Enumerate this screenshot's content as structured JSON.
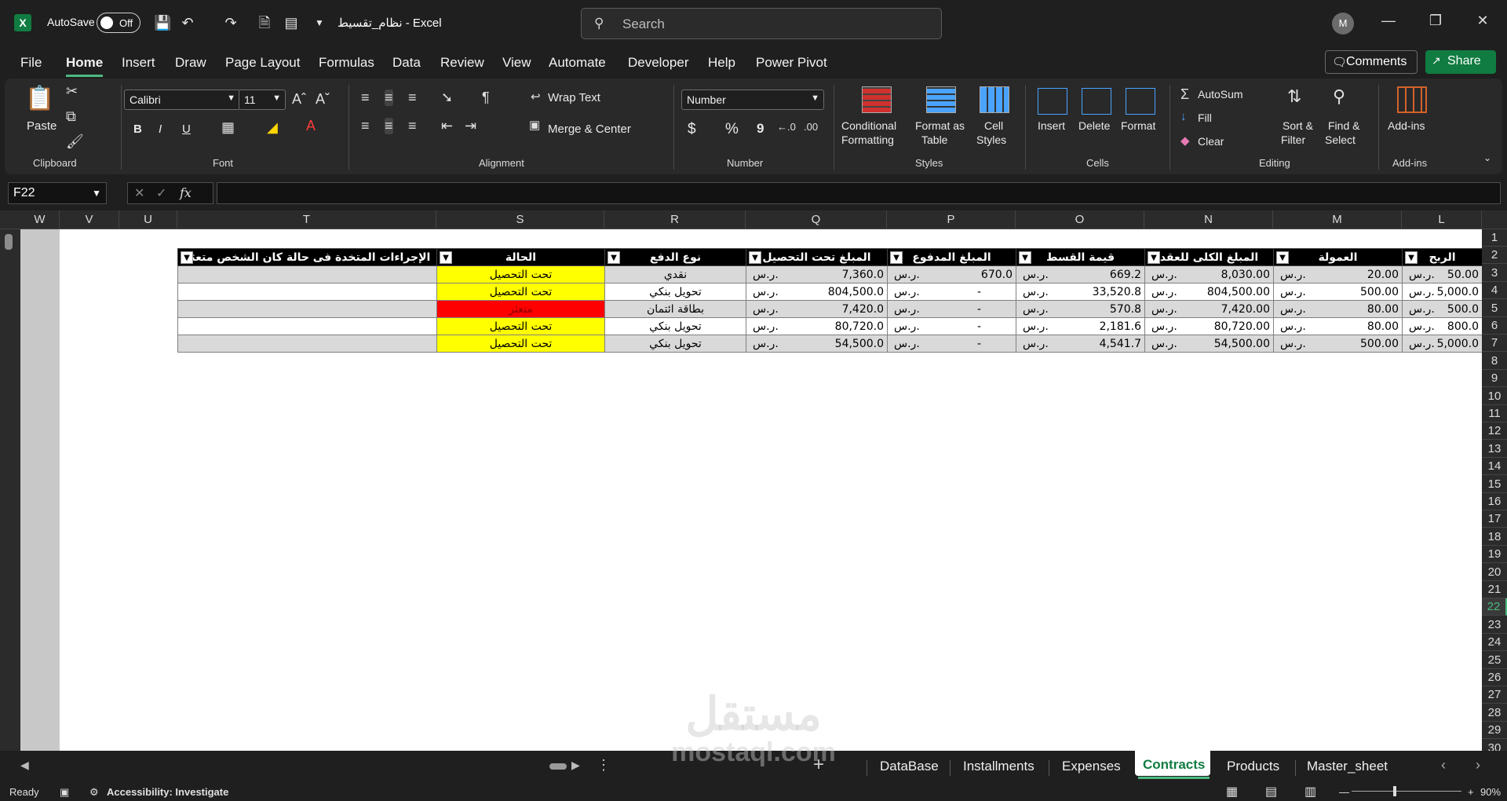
{
  "titlebar": {
    "autosave_label": "AutoSave",
    "autosave_state": "Off",
    "document_title": "نظام_تقسيط  -  Excel",
    "search_placeholder": "Search",
    "avatar_initial": "M"
  },
  "menu": {
    "tabs": [
      "File",
      "Home",
      "Insert",
      "Draw",
      "Page Layout",
      "Formulas",
      "Data",
      "Review",
      "View",
      "Automate",
      "Developer",
      "Help",
      "Power Pivot"
    ],
    "active_tab": "Home",
    "comments_label": "Comments",
    "share_label": "Share"
  },
  "ribbon": {
    "clipboard": {
      "paste": "Paste",
      "label": "Clipboard"
    },
    "font": {
      "family": "Calibri",
      "size": "11",
      "label": "Font",
      "bold": "B",
      "italic": "I",
      "underline": "U"
    },
    "alignment": {
      "wrap_text": "Wrap Text",
      "merge_center": "Merge & Center",
      "label": "Alignment"
    },
    "number": {
      "format": "Number",
      "label": "Number",
      "currency": "$",
      "percent": "%",
      "comma": "9"
    },
    "styles": {
      "conditional": "Conditional",
      "conditional2": "Formatting",
      "format_as": "Format as",
      "format_as2": "Table",
      "cell": "Cell",
      "cell2": "Styles",
      "label": "Styles"
    },
    "cells": {
      "insert": "Insert",
      "delete": "Delete",
      "format": "Format",
      "label": "Cells"
    },
    "editing": {
      "autosum": "AutoSum",
      "fill": "Fill",
      "clear": "Clear",
      "sort": "Sort &",
      "sort2": "Filter",
      "find": "Find &",
      "find2": "Select",
      "label": "Editing"
    },
    "addins": {
      "button": "Add-ins",
      "label": "Add-ins"
    }
  },
  "formula_bar": {
    "name_box": "F22",
    "formula": ""
  },
  "grid": {
    "columns": [
      "W",
      "V",
      "U",
      "T",
      "S",
      "R",
      "Q",
      "P",
      "O",
      "N",
      "M",
      "L"
    ],
    "rows": [
      "1",
      "2",
      "3",
      "4",
      "5",
      "6",
      "7",
      "8",
      "9",
      "10",
      "11",
      "12",
      "13",
      "14",
      "15",
      "16",
      "17",
      "18",
      "19",
      "20",
      "21",
      "22",
      "23",
      "24",
      "25",
      "26",
      "27",
      "28",
      "29",
      "30"
    ],
    "selected_row": "22"
  },
  "table": {
    "headers": {
      "actions": "الإجراءات المتخدة فى حالة كان الشخص متعثر",
      "status": "الحالة",
      "payment_type": "نوع الدفع",
      "amount_pending": "المبلغ تحت التحصيل",
      "amount_paid": "المبلغ المدفوع",
      "installment": "قيمة القسط",
      "total": "المبلغ الكلى للعقد",
      "commission": "العمولة",
      "profit": "الربح"
    },
    "currency": "ر.س.",
    "dash": "-",
    "rows": [
      {
        "status": "تحت التحصيل",
        "status_color": "yellow",
        "payment_type": "نقدي",
        "amount_pending": "7,360.0",
        "amount_paid": "670.0",
        "installment": "669.2",
        "total": "8,030.00",
        "commission": "20.00",
        "profit": "50.00"
      },
      {
        "status": "تحت التحصيل",
        "status_color": "yellow",
        "payment_type": "تحويل بنكي",
        "amount_pending": "804,500.0",
        "amount_paid": "",
        "installment": "33,520.8",
        "total": "804,500.00",
        "commission": "500.00",
        "profit": "5,000.0"
      },
      {
        "status": "متعثر",
        "status_color": "red",
        "payment_type": "بطاقة ائتمان",
        "amount_pending": "7,420.0",
        "amount_paid": "",
        "installment": "570.8",
        "total": "7,420.00",
        "commission": "80.00",
        "profit": "500.0"
      },
      {
        "status": "تحت التحصيل",
        "status_color": "yellow",
        "payment_type": "تحويل بنكي",
        "amount_pending": "80,720.0",
        "amount_paid": "",
        "installment": "2,181.6",
        "total": "80,720.00",
        "commission": "80.00",
        "profit": "800.0"
      },
      {
        "status": "تحت التحصيل",
        "status_color": "yellow",
        "payment_type": "تحويل بنكي",
        "amount_pending": "54,500.0",
        "amount_paid": "",
        "installment": "4,541.7",
        "total": "54,500.00",
        "commission": "500.00",
        "profit": "5,000.0"
      }
    ]
  },
  "sheets": {
    "tabs": [
      "DataBase",
      "Installments",
      "Expenses",
      "Contracts",
      "Products",
      "Master_sheet"
    ],
    "active": "Contracts"
  },
  "statusbar": {
    "ready": "Ready",
    "accessibility": "Accessibility: Investigate",
    "zoom": "90%"
  },
  "watermark": {
    "arabic": "مستقل",
    "latin": "mostaql.com"
  }
}
